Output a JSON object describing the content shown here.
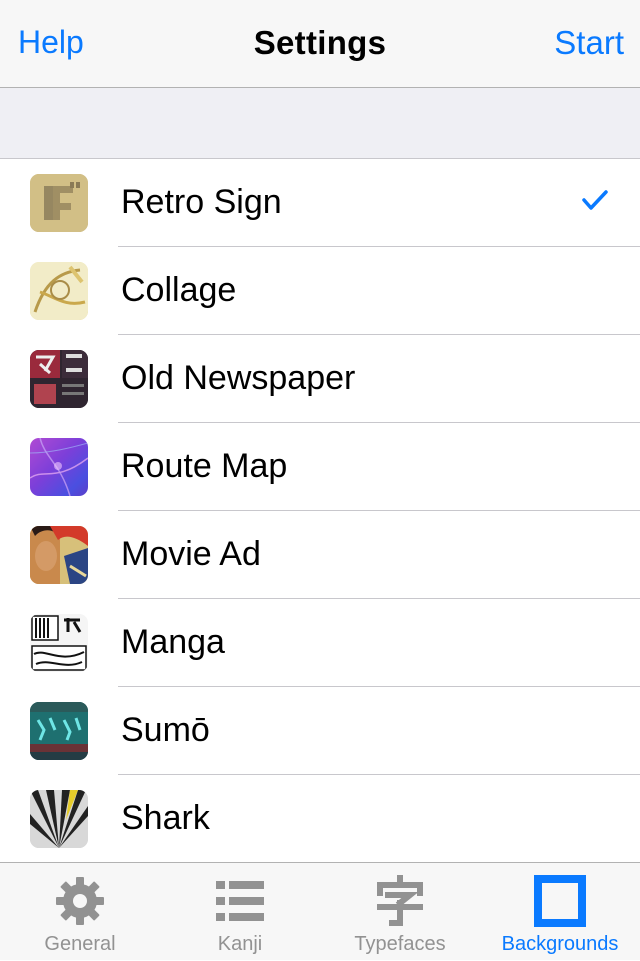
{
  "nav": {
    "left_label": "Help",
    "title": "Settings",
    "right_label": "Start"
  },
  "colors": {
    "accent": "#0a7aff",
    "inactive": "#929292",
    "separator": "#c8c7cc"
  },
  "backgrounds": {
    "items": [
      {
        "label": "Retro Sign",
        "selected": true,
        "thumb": "retro-sign-thumbnail"
      },
      {
        "label": "Collage",
        "selected": false,
        "thumb": "collage-thumbnail"
      },
      {
        "label": "Old Newspaper",
        "selected": false,
        "thumb": "old-newspaper-thumbnail"
      },
      {
        "label": "Route Map",
        "selected": false,
        "thumb": "route-map-thumbnail"
      },
      {
        "label": "Movie Ad",
        "selected": false,
        "thumb": "movie-ad-thumbnail"
      },
      {
        "label": "Manga",
        "selected": false,
        "thumb": "manga-thumbnail"
      },
      {
        "label": "Sumō",
        "selected": false,
        "thumb": "sumo-thumbnail"
      },
      {
        "label": "Shark",
        "selected": false,
        "thumb": "shark-thumbnail"
      }
    ]
  },
  "tabs": [
    {
      "label": "General",
      "icon": "gear-icon",
      "active": false
    },
    {
      "label": "Kanji",
      "icon": "list-icon",
      "active": false
    },
    {
      "label": "Typefaces",
      "icon": "kanji-character-icon",
      "active": false
    },
    {
      "label": "Backgrounds",
      "icon": "square-icon",
      "active": true
    }
  ]
}
